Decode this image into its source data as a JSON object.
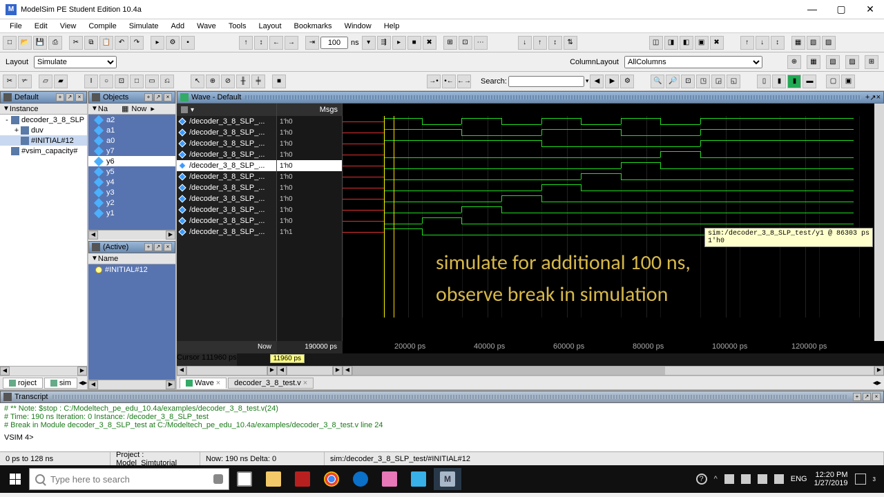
{
  "window": {
    "title": "ModelSim PE Student Edition 10.4a"
  },
  "menu": [
    "File",
    "Edit",
    "View",
    "Compile",
    "Simulate",
    "Add",
    "Wave",
    "Tools",
    "Layout",
    "Bookmarks",
    "Window",
    "Help"
  ],
  "layout": {
    "label": "Layout",
    "value": "Simulate"
  },
  "columnlayout": {
    "label": "ColumnLayout",
    "value": "AllColumns"
  },
  "runtime": {
    "value": "100",
    "unit": "ns"
  },
  "search": {
    "label": "Search:",
    "value": ""
  },
  "sim_panel": {
    "title": "Default",
    "subheader": "Instance",
    "tree": [
      {
        "label": "decoder_3_8_SLP",
        "indent": 0,
        "expand": "-"
      },
      {
        "label": "duv",
        "indent": 1,
        "expand": "+"
      },
      {
        "label": "#INITIAL#12",
        "indent": 1,
        "expand": "",
        "selected": true
      },
      {
        "label": "#vsim_capacity#",
        "indent": 0,
        "expand": ""
      }
    ]
  },
  "objects_panel": {
    "title": "Objects",
    "subheader_name": "Na",
    "subheader_now": "Now",
    "items": [
      "a2",
      "a1",
      "a0",
      "y7",
      "y6",
      "y5",
      "y4",
      "y3",
      "y2",
      "y1"
    ],
    "selected_index": 4
  },
  "active_panel": {
    "title": "(Active)",
    "subheader": "Name",
    "items": [
      "#INITIAL#12"
    ]
  },
  "wave_panel": {
    "title": "Wave - Default",
    "msgs_header": "Msgs",
    "signals": [
      {
        "name": "/decoder_3_8_SLP_...",
        "value": "1'h0"
      },
      {
        "name": "/decoder_3_8_SLP_...",
        "value": "1'h0"
      },
      {
        "name": "/decoder_3_8_SLP_...",
        "value": "1'h0"
      },
      {
        "name": "/decoder_3_8_SLP_...",
        "value": "1'h0"
      },
      {
        "name": "/decoder_3_8_SLP_...",
        "value": "1'h0",
        "selected": true
      },
      {
        "name": "/decoder_3_8_SLP_...",
        "value": "1'h0"
      },
      {
        "name": "/decoder_3_8_SLP_...",
        "value": "1'h0"
      },
      {
        "name": "/decoder_3_8_SLP_...",
        "value": "1'h0"
      },
      {
        "name": "/decoder_3_8_SLP_...",
        "value": "1'h0"
      },
      {
        "name": "/decoder_3_8_SLP_...",
        "value": "1'h0"
      },
      {
        "name": "/decoder_3_8_SLP_...",
        "value": "1'h1"
      }
    ],
    "now_label": "Now",
    "now_value": "190000 ps",
    "cursor_label": "Cursor 1",
    "cursor_value": "11960 ps",
    "cursor_box": "11960 ps",
    "ticks": [
      {
        "pos": 95,
        "label": "20000 ps"
      },
      {
        "pos": 210,
        "label": "40000 ps"
      },
      {
        "pos": 325,
        "label": "60000 ps"
      },
      {
        "pos": 440,
        "label": "80000 ps"
      },
      {
        "pos": 555,
        "label": "100000 ps"
      },
      {
        "pos": 670,
        "label": "120000 ps"
      }
    ],
    "tooltip": "sim:/decoder_3_8_SLP_test/y1 @ 86303 ps\n1'h0",
    "overlay1": "simulate for additional 100 ns,",
    "overlay2": "observe break in simulation"
  },
  "tabs_left": [
    {
      "label": "roject"
    },
    {
      "label": "sim"
    }
  ],
  "tabs_wave": [
    {
      "label": "Wave",
      "active": true
    },
    {
      "label": "decoder_3_8_test.v"
    }
  ],
  "transcript": {
    "title": "Transcript",
    "lines": [
      "# ** Note: $stop    : C:/Modeltech_pe_edu_10.4a/examples/decoder_3_8_test.v(24)",
      "#    Time: 190 ns  Iteration: 0  Instance: /decoder_3_8_SLP_test",
      "# Break in Module decoder_3_8_SLP_test at C:/Modeltech_pe_edu_10.4a/examples/decoder_3_8_test.v line 24"
    ],
    "prompt": "VSIM 4>"
  },
  "status": {
    "range": "0 ps to 128 ns",
    "project": "Project : Model_Simtutorial",
    "now": "Now: 190 ns  Delta: 0",
    "scope": "sim:/decoder_3_8_SLP_test/#INITIAL#12"
  },
  "taskbar": {
    "search_placeholder": "Type here to search",
    "lang": "ENG",
    "time": "12:20 PM",
    "date": "1/27/2019",
    "count": "3"
  }
}
